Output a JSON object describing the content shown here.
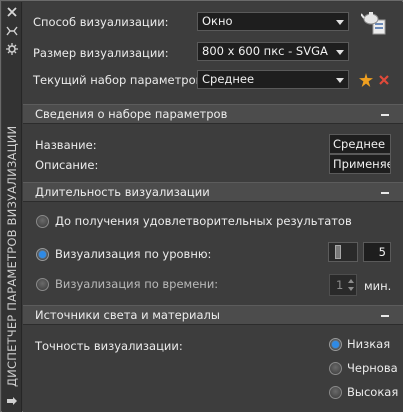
{
  "palette": {
    "panel": "#3d3d3d",
    "section": "#4c4c4c",
    "field": "#1e1e1e",
    "accent_radio": "#2e8ae6",
    "star": "#f0a020",
    "delete": "#e04a3a"
  },
  "window": {
    "title": "ДИСПЕТЧЕР ПАРАМЕТРОВ ВИЗУАЛИЗАЦИИ",
    "controls": {
      "close_icon": "close-x-icon",
      "pin_icon": "auto-hide-icon",
      "props_icon": "properties-icon"
    }
  },
  "top": {
    "render_mode": {
      "label": "Способ визуализации:",
      "value": "Окно"
    },
    "render_size": {
      "label": "Размер визуализации:",
      "value": "800 x 600 пкс - SVGA"
    },
    "preset": {
      "label": "Текущий набор параметров:",
      "value": "Среднее"
    },
    "render_icon": "render-teapot-icon",
    "new_preset_icon": "star-icon",
    "delete_preset_icon": "delete-x-icon"
  },
  "preset_info": {
    "title": "Сведения о наборе параметров",
    "name_label": "Название:",
    "name_value": "Среднее",
    "desc_label": "Описание:",
    "desc_value": "Применяет"
  },
  "duration": {
    "title": "Длительность визуализации",
    "options": [
      {
        "label": "До получения удовлетворительных результатов",
        "selected": false
      },
      {
        "label": "Визуализация по уровню:",
        "selected": true
      },
      {
        "label": "Визуализация по времени:",
        "selected": false
      }
    ],
    "level_value": "5",
    "time_value": "1",
    "time_unit": "мин."
  },
  "lights": {
    "title": "Источники света и материалы",
    "accuracy_label": "Точность визуализации:",
    "options": [
      {
        "label": "Низкая",
        "selected": true
      },
      {
        "label": "Чернова",
        "selected": false
      },
      {
        "label": "Высокая",
        "selected": false
      }
    ]
  }
}
